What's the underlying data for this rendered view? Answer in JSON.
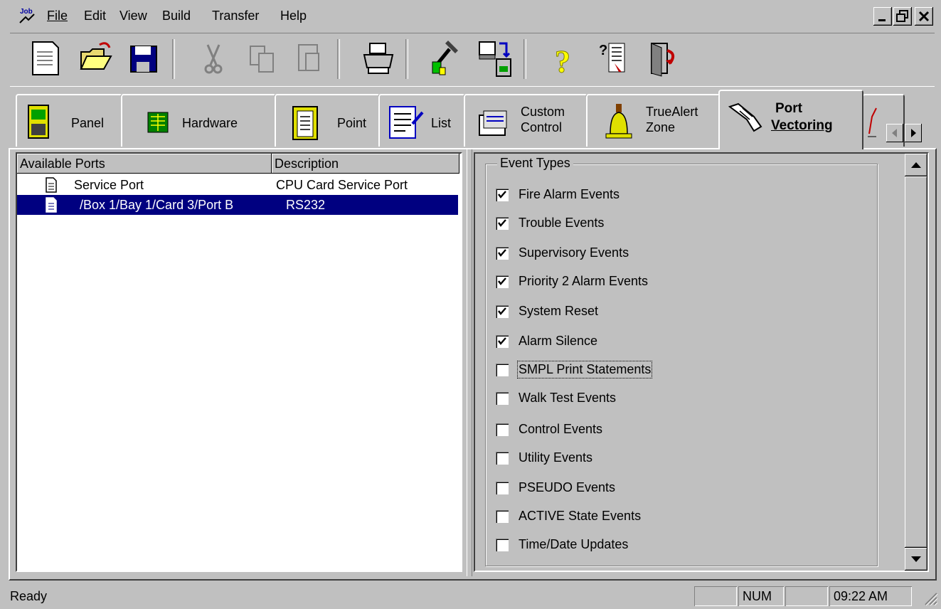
{
  "menu": {
    "items": [
      "File",
      "Edit",
      "View",
      "Build",
      "Transfer",
      "Help"
    ],
    "app_icon_text": "Job"
  },
  "window_controls": {
    "minimize": "_",
    "restore": "̅",
    "close": "×"
  },
  "toolbar": {
    "buttons": [
      {
        "icon": "new-document-icon",
        "enabled": true
      },
      {
        "icon": "open-folder-icon",
        "enabled": true
      },
      {
        "icon": "save-disk-icon",
        "enabled": true
      },
      {
        "icon": "cut-icon",
        "enabled": false
      },
      {
        "icon": "copy-icon",
        "enabled": false
      },
      {
        "icon": "paste-icon",
        "enabled": false
      },
      {
        "icon": "print-icon",
        "enabled": true
      },
      {
        "icon": "build-hammer-icon",
        "enabled": true
      },
      {
        "icon": "transfer-icon",
        "enabled": true
      },
      {
        "icon": "help-icon",
        "enabled": true
      },
      {
        "icon": "context-help-icon",
        "enabled": true
      },
      {
        "icon": "exit-icon",
        "enabled": true
      }
    ]
  },
  "tabs": [
    {
      "label": "Panel",
      "icon": "panel-icon"
    },
    {
      "label": "Hardware",
      "icon": "hardware-chip-icon"
    },
    {
      "label": "Point",
      "icon": "clipboard-icon"
    },
    {
      "label": "List",
      "icon": "list-icon"
    },
    {
      "label_line1": "Custom",
      "label_line2": "Control",
      "icon": "custom-control-icon"
    },
    {
      "label_line1": "TrueAlert",
      "label_line2": "Zone",
      "icon": "bell-icon"
    },
    {
      "label_line1": "Port",
      "label_line2": "Vectoring",
      "icon": "port-vectoring-hand-icon",
      "active": true
    }
  ],
  "ports_list": {
    "columns": [
      "Available Ports",
      "Description"
    ],
    "rows": [
      {
        "port": "Service Port",
        "description": "CPU Card Service Port",
        "selected": false
      },
      {
        "port": "/Box 1/Bay 1/Card 3/Port B",
        "description": "RS232",
        "selected": true
      }
    ]
  },
  "event_types": {
    "legend": "Event Types",
    "items": [
      {
        "label": "Fire Alarm Events",
        "checked": true
      },
      {
        "label": "Trouble Events",
        "checked": true
      },
      {
        "label": "Supervisory Events",
        "checked": true
      },
      {
        "label": "Priority 2 Alarm Events",
        "checked": true
      },
      {
        "label": "System Reset",
        "checked": true
      },
      {
        "label": "Alarm Silence",
        "checked": true
      },
      {
        "label": "SMPL Print Statements",
        "checked": false,
        "focused": true
      },
      {
        "label": "Walk Test Events",
        "checked": false
      },
      {
        "label": "Control Events",
        "checked": false
      },
      {
        "label": "Utility Events",
        "checked": false
      },
      {
        "label": "PSEUDO Events",
        "checked": false
      },
      {
        "label": "ACTIVE State Events",
        "checked": false
      },
      {
        "label": "Time/Date Updates",
        "checked": false
      }
    ]
  },
  "status_bar": {
    "text": "Ready",
    "num": "NUM",
    "time": "09:22 AM"
  },
  "colors": {
    "face": "#c0c0c0",
    "selection": "#000080"
  }
}
